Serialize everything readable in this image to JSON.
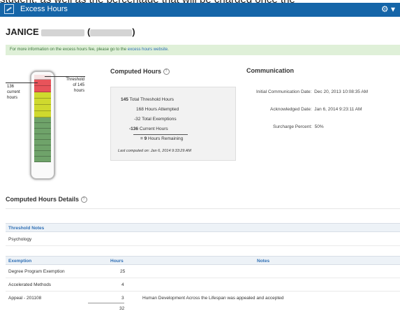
{
  "top_partial_text": "student, as well as the percentage that will be charged once the",
  "appbar": {
    "title": "Excess Hours",
    "logo_icon": "excess-hours-logo",
    "settings_icon": "gear-icon",
    "color": "#1565a8"
  },
  "student": {
    "first_name": "JANICE",
    "paren_open": "(",
    "paren_close": ")"
  },
  "info_bar": {
    "text": "For more information on the excess hours fee, please go to the",
    "link": "excess hours website",
    "end": "."
  },
  "gauge": {
    "threshold_label_lines": [
      "Threshold",
      "of 145",
      "hours"
    ],
    "current_label_lines": [
      "136",
      "current",
      "hours"
    ],
    "threshold_hours": 145,
    "current_hours": 136
  },
  "computed": {
    "heading": "Computed Hours",
    "threshold_value": "145",
    "threshold_text": "Total Threshold Hours",
    "attempted": "168 Hours Attempted",
    "exemptions": "-32 Total Exemptions",
    "current_value": "-136",
    "current_text": "Current Hours",
    "remaining_value": "= 9",
    "remaining_text": "Hours Remaining",
    "last_computed": "Last computed on: Jan 6, 2014 9:33:29 AM"
  },
  "communication": {
    "heading": "Communication",
    "initial_label": "Initial Communication Date:",
    "initial_value": "Dec 20, 2013 10:08:35 AM",
    "ack_label": "Acknowledged Date:",
    "ack_value": "Jan 6, 2014 9:23:11 AM",
    "surcharge_label": "Surcharge Percent:",
    "surcharge_value": "50%"
  },
  "details": {
    "heading": "Computed Hours Details",
    "threshold_notes_header": "Threshold Notes",
    "threshold_notes_value": "Psychology",
    "columns": [
      "Exemption",
      "Hours",
      "Notes"
    ],
    "rows": [
      {
        "exemption": "Degree Program Exemption",
        "hours": "25",
        "notes": ""
      },
      {
        "exemption": "Accelerated Methods",
        "hours": "4",
        "notes": ""
      },
      {
        "exemption": "Appeal - 201108",
        "hours": "3",
        "notes": "Human Development Across the Lifespan was appealed and accepted"
      }
    ],
    "total": "32"
  },
  "colors": {
    "red": "#e8535a",
    "yellow": "#cfd92e",
    "green": "#6fa36a",
    "blank": "#f6e2e2"
  }
}
